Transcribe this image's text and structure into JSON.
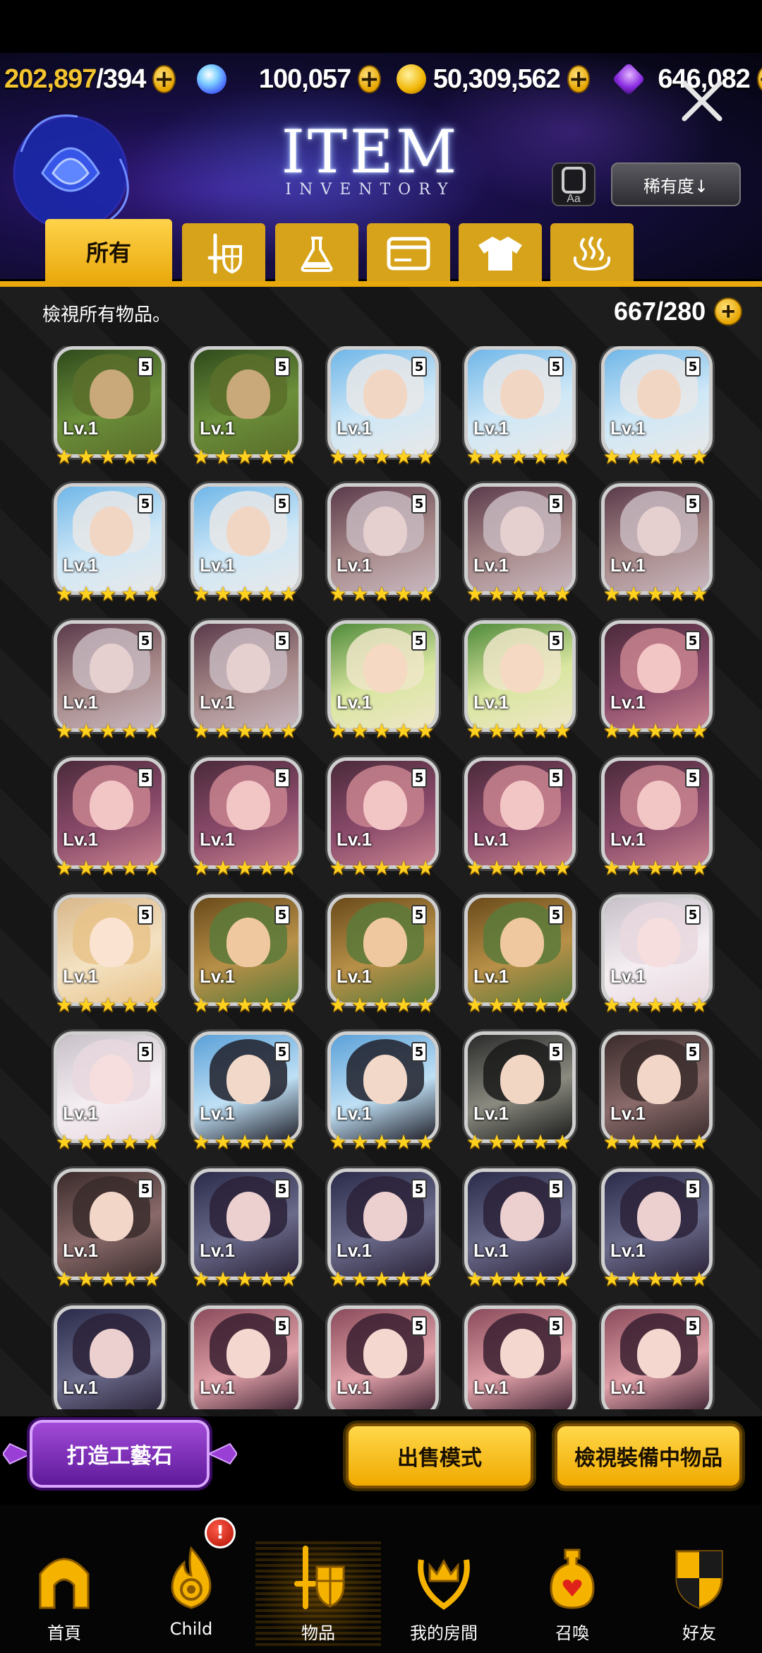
{
  "resources": {
    "stamina_current": "202,897",
    "stamina_max": "/394",
    "crystals": "100,057",
    "gold": "50,309,562",
    "gems": "646,082"
  },
  "header": {
    "title": "ITEM",
    "subtitle": "INVENTORY",
    "font_button": "Aa",
    "sort_label": "稀有度↓"
  },
  "tabs": [
    {
      "label": "所有",
      "icon": "all-items",
      "active": true
    },
    {
      "label": "",
      "icon": "sword-shield-icon"
    },
    {
      "label": "",
      "icon": "flask-icon"
    },
    {
      "label": "",
      "icon": "card-icon"
    },
    {
      "label": "",
      "icon": "shirt-icon"
    },
    {
      "label": "",
      "icon": "hot-spring-icon"
    }
  ],
  "info": {
    "description": "檢視所有物品。",
    "count": "667/280"
  },
  "items": [
    {
      "level": "Lv.1",
      "rank": "5",
      "stars": 5,
      "theme": "green"
    },
    {
      "level": "Lv.1",
      "rank": "5",
      "stars": 5,
      "theme": "green"
    },
    {
      "level": "Lv.1",
      "rank": "5",
      "stars": 5,
      "theme": "sky"
    },
    {
      "level": "Lv.1",
      "rank": "5",
      "stars": 5,
      "theme": "sky"
    },
    {
      "level": "Lv.1",
      "rank": "5",
      "stars": 5,
      "theme": "sky"
    },
    {
      "level": "Lv.1",
      "rank": "5",
      "stars": 5,
      "theme": "sky"
    },
    {
      "level": "Lv.1",
      "rank": "5",
      "stars": 5,
      "theme": "sky"
    },
    {
      "level": "Lv.1",
      "rank": "5",
      "stars": 5,
      "theme": "mauve"
    },
    {
      "level": "Lv.1",
      "rank": "5",
      "stars": 5,
      "theme": "mauve"
    },
    {
      "level": "Lv.1",
      "rank": "5",
      "stars": 5,
      "theme": "mauve"
    },
    {
      "level": "Lv.1",
      "rank": "5",
      "stars": 5,
      "theme": "mauve"
    },
    {
      "level": "Lv.1",
      "rank": "5",
      "stars": 5,
      "theme": "mauve"
    },
    {
      "level": "Lv.1",
      "rank": "5",
      "stars": 5,
      "theme": "beach"
    },
    {
      "level": "Lv.1",
      "rank": "5",
      "stars": 5,
      "theme": "beach"
    },
    {
      "level": "Lv.1",
      "rank": "5",
      "stars": 5,
      "theme": "pink"
    },
    {
      "level": "Lv.1",
      "rank": "5",
      "stars": 5,
      "theme": "pink"
    },
    {
      "level": "Lv.1",
      "rank": "5",
      "stars": 5,
      "theme": "pink"
    },
    {
      "level": "Lv.1",
      "rank": "5",
      "stars": 5,
      "theme": "pink"
    },
    {
      "level": "Lv.1",
      "rank": "5",
      "stars": 5,
      "theme": "pink"
    },
    {
      "level": "Lv.1",
      "rank": "5",
      "stars": 5,
      "theme": "pink"
    },
    {
      "level": "Lv.1",
      "rank": "5",
      "stars": 5,
      "theme": "cream"
    },
    {
      "level": "Lv.1",
      "rank": "5",
      "stars": 5,
      "theme": "olive"
    },
    {
      "level": "Lv.1",
      "rank": "5",
      "stars": 5,
      "theme": "olive"
    },
    {
      "level": "Lv.1",
      "rank": "5",
      "stars": 5,
      "theme": "olive"
    },
    {
      "level": "Lv.1",
      "rank": "5",
      "stars": 5,
      "theme": "white"
    },
    {
      "level": "Lv.1",
      "rank": "5",
      "stars": 5,
      "theme": "white"
    },
    {
      "level": "Lv.1",
      "rank": "5",
      "stars": 5,
      "theme": "ocean"
    },
    {
      "level": "Lv.1",
      "rank": "5",
      "stars": 5,
      "theme": "ocean"
    },
    {
      "level": "Lv.1",
      "rank": "5",
      "stars": 5,
      "theme": "dark"
    },
    {
      "level": "Lv.1",
      "rank": "5",
      "stars": 5,
      "theme": "bow"
    },
    {
      "level": "Lv.1",
      "rank": "5",
      "stars": 5,
      "theme": "bow"
    },
    {
      "level": "Lv.1",
      "rank": "5",
      "stars": 5,
      "theme": "violet"
    },
    {
      "level": "Lv.1",
      "rank": "5",
      "stars": 5,
      "theme": "violet"
    },
    {
      "level": "Lv.1",
      "rank": "5",
      "stars": 5,
      "theme": "violet"
    },
    {
      "level": "Lv.1",
      "rank": "5",
      "stars": 5,
      "theme": "violet"
    },
    {
      "level": "Lv.1",
      "rank": "",
      "stars": 0,
      "theme": "violet"
    },
    {
      "level": "Lv.1",
      "rank": "5",
      "stars": 0,
      "theme": "flower"
    },
    {
      "level": "Lv.1",
      "rank": "5",
      "stars": 0,
      "theme": "flower"
    },
    {
      "level": "Lv.1",
      "rank": "5",
      "stars": 0,
      "theme": "flower"
    },
    {
      "level": "Lv.1",
      "rank": "5",
      "stars": 0,
      "theme": "flower"
    }
  ],
  "actions": {
    "craft": "打造工藝石",
    "sell": "出售模式",
    "view_equipped": "檢視裝備中物品"
  },
  "nav": [
    {
      "label": "首頁",
      "icon": "home-arch-icon"
    },
    {
      "label": "Child",
      "icon": "flame-icon",
      "alert": "!"
    },
    {
      "label": "物品",
      "icon": "sword-shield-icon",
      "active": true
    },
    {
      "label": "我的房間",
      "icon": "crown-wreath-icon"
    },
    {
      "label": "召喚",
      "icon": "potion-icon"
    },
    {
      "label": "好友",
      "icon": "shield-icon"
    }
  ],
  "colors": {
    "gold": "#f4c430",
    "tab_active": "#ffd34a",
    "craft_purple": "#8a34c6"
  }
}
